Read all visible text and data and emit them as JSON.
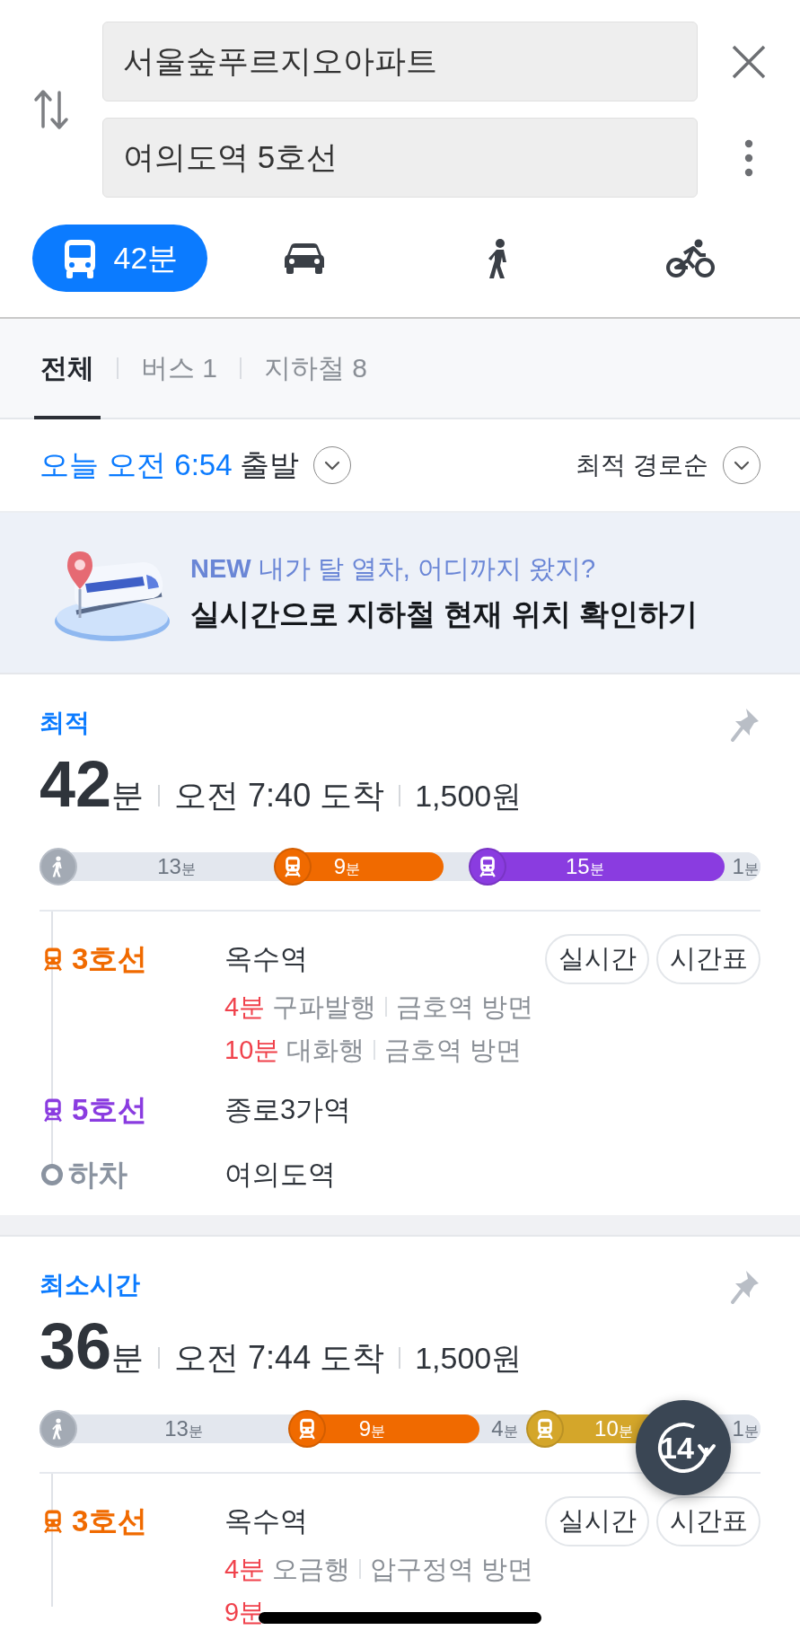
{
  "route_inputs": [
    {
      "value": "서울숲푸르지오아파트"
    },
    {
      "value": "여의도역 5호선"
    }
  ],
  "modes": [
    {
      "kind": "bus",
      "label": "42분",
      "selected": true
    },
    {
      "kind": "car",
      "selected": false
    },
    {
      "kind": "walk",
      "selected": false
    },
    {
      "kind": "bike",
      "selected": false
    }
  ],
  "filter_tabs": [
    {
      "label": "전체",
      "selected": true
    },
    {
      "label": "버스 1",
      "selected": false
    },
    {
      "label": "지하철 8",
      "selected": false
    }
  ],
  "departure": {
    "time": "오늘 오전 6:54",
    "suffix": "출발"
  },
  "sort": {
    "label": "최적 경로순"
  },
  "banner": {
    "headline": "**NEW** 내가 탈 열차, 어디까지 왔지?",
    "title": "실시간으로 지하철 현재 위치 확인하기"
  },
  "routes": [
    {
      "tag": "최적",
      "duration": "42",
      "unit": "분",
      "arrival": "오전 7:40 도착",
      "fare": "1,500원",
      "segments": [
        {
          "kind": "walk",
          "minutes": "13",
          "unit": "분"
        },
        {
          "kind": "ride",
          "color": "#f06a00",
          "minutes": "9",
          "unit": "분"
        },
        {
          "kind": "walk"
        },
        {
          "kind": "ride",
          "color": "#8a3ce0",
          "minutes": "15",
          "unit": "분"
        },
        {
          "kind": "walk",
          "minutes": "1",
          "unit": "분"
        }
      ],
      "steps": [
        {
          "kind": "ride",
          "line": "3호선",
          "color": "#f06a00",
          "station": "옥수역",
          "buttons": [
            "실시간",
            "시간표"
          ],
          "arrivals": [
            {
              "time": "4분",
              "train": "구파발행",
              "direction": "금호역 방면"
            },
            {
              "time": "10분",
              "train": "대화행",
              "direction": "금호역 방면"
            }
          ]
        },
        {
          "kind": "ride",
          "line": "5호선",
          "color": "#8a3ce0",
          "station": "종로3가역"
        },
        {
          "kind": "alight",
          "line": "하차",
          "station": "여의도역"
        }
      ]
    },
    {
      "tag": "최소시간",
      "duration": "36",
      "unit": "분",
      "arrival": "오전 7:44 도착",
      "fare": "1,500원",
      "segments": [
        {
          "kind": "walk",
          "minutes": "13",
          "unit": "분"
        },
        {
          "kind": "ride",
          "color": "#f06a00",
          "minutes": "9",
          "unit": "분"
        },
        {
          "kind": "walk",
          "minutes": "4",
          "unit": "분"
        },
        {
          "kind": "ride",
          "color": "#d4a62a",
          "minutes": "10",
          "unit": "분"
        },
        {
          "kind": "walk",
          "minutes": "1",
          "unit": "분"
        }
      ],
      "steps": [
        {
          "kind": "ride",
          "line": "3호선",
          "color": "#f06a00",
          "station": "옥수역",
          "buttons": [
            "실시간",
            "시간표"
          ],
          "arrivals": [
            {
              "time": "4분",
              "train": "오금행",
              "direction": "압구정역 방면"
            },
            {
              "time": "9분"
            }
          ]
        }
      ]
    }
  ],
  "floating_button": {
    "label": "14"
  }
}
